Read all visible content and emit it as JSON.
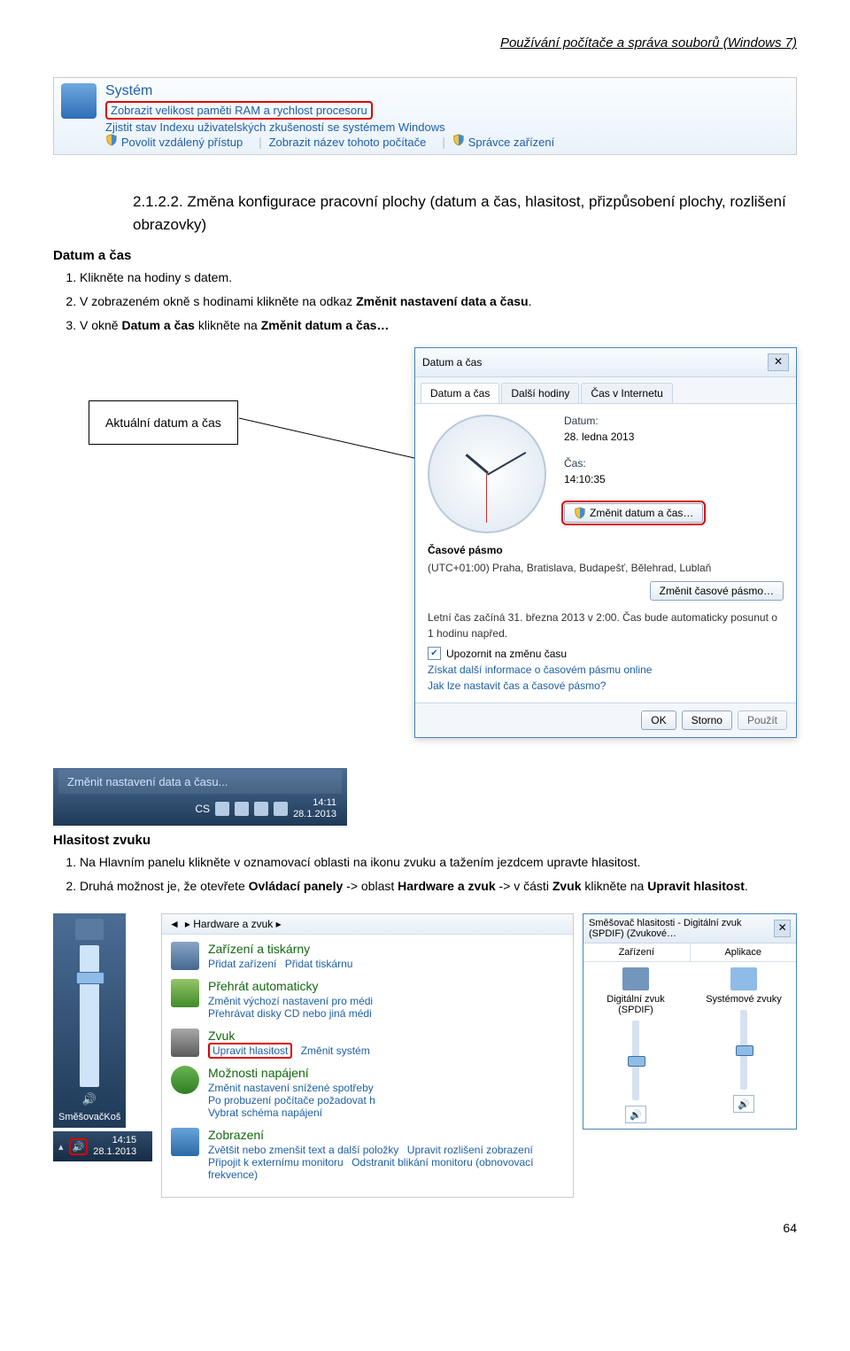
{
  "page": {
    "header": "Používání počítače a správa souborů (Windows 7)",
    "number": "64"
  },
  "control_panel_strip": {
    "title": "Systém",
    "link_ram": "Zobrazit velikost paměti RAM a rychlost procesoru",
    "link_index": "Zjistit stav Indexu uživatelských zkušeností se systémem Windows",
    "link_remote": "Povolit vzdálený přístup",
    "link_name": "Zobrazit název tohoto počítače",
    "link_devmgr": "Správce zařízení"
  },
  "section": {
    "number_title": "2.1.2.2. Změna konfigurace pracovní plochy (datum a čas, hlasitost, přizpůsobení plochy, rozlišení obrazovky)",
    "datum_label": "Datum a čas",
    "steps_datetime": [
      "Klikněte na hodiny s datem.",
      "V zobrazeném okně s hodinami klikněte na odkaz Změnit nastavení data a času.",
      "V okně Datum a čas klikněte na Změnit datum a čas…"
    ],
    "callout": "Aktuální datum a čas",
    "hlasitost_label": "Hlasitost zvuku",
    "steps_volume": [
      "Na Hlavním panelu klikněte v oznamovací oblasti na ikonu zvuku a tažením jezdcem upravte hlasitost.",
      "Druhá možnost je, že otevřete Ovládací panely -> oblast Hardware a zvuk -> v části Zvuk klikněte na Upravit hlasitost."
    ]
  },
  "datetime_dialog": {
    "title": "Datum a čas",
    "tab1": "Datum a čas",
    "tab2": "Další hodiny",
    "tab3": "Čas v Internetu",
    "date_label": "Datum:",
    "date_value": "28. ledna 2013",
    "time_label": "Čas:",
    "time_value": "14:10:35",
    "btn_change_dt": "Změnit datum a čas…",
    "tz_section": "Časové pásmo",
    "tz_value": "(UTC+01:00) Praha, Bratislava, Budapešť, Bělehrad, Lublaň",
    "btn_change_tz": "Změnit časové pásmo…",
    "dst_text": "Letní čas začíná 31. března 2013 v 2:00. Čas bude automaticky posunut o 1 hodinu napřed.",
    "chk_notify": "Upozornit na změnu času",
    "link_more_tz": "Získat další informace o časovém pásmu online",
    "link_how": "Jak lze nastavit čas a časové pásmo?",
    "btn_ok": "OK",
    "btn_cancel": "Storno",
    "btn_apply": "Použít"
  },
  "taskbar_frag": {
    "link": "Změnit nastavení data a času...",
    "lang": "CS",
    "time": "14:11",
    "date": "28.1.2013"
  },
  "vol_panel": {
    "label_top_icon": "",
    "label_bottom": "Směšovač",
    "label_kos": "Koš"
  },
  "tray2": {
    "time": "14:15",
    "date": "28.1.2013"
  },
  "hw_sound": {
    "breadcrumb": "▸ Hardware a zvuk ▸",
    "cat_devices_title": "Zařízení a tiskárny",
    "cat_devices_links": [
      "Přidat zařízení",
      "Přidat tiskárnu"
    ],
    "cat_autoplay_title": "Přehrát automaticky",
    "cat_autoplay_links": [
      "Změnit výchozí nastavení pro médi",
      "Přehrávat disky CD nebo jiná médi"
    ],
    "cat_sound_title": "Zvuk",
    "cat_sound_links": [
      "Upravit hlasitost",
      "Změnit systém"
    ],
    "cat_power_title": "Možnosti napájení",
    "cat_power_links": [
      "Změnit nastavení snížené spotřeby",
      "Po probuzení počítače požadovat h",
      "Vybrat schéma napájení"
    ],
    "cat_display_title": "Zobrazení",
    "cat_display_links": [
      "Zvětšit nebo zmenšit text a další položky",
      "Upravit rozlišení zobrazení",
      "Připojit k externímu monitoru",
      "Odstranit blikání monitoru (obnovovací frekvence)"
    ]
  },
  "mixer": {
    "title": "Směšovač hlasitosti - Digitální zvuk (SPDIF) (Zvukové…",
    "col_device_header": "Zařízení",
    "col_app_header": "Aplikace",
    "dev_name": "Digitální zvuk (SPDIF)",
    "app_name": "Systémové zvuky"
  }
}
